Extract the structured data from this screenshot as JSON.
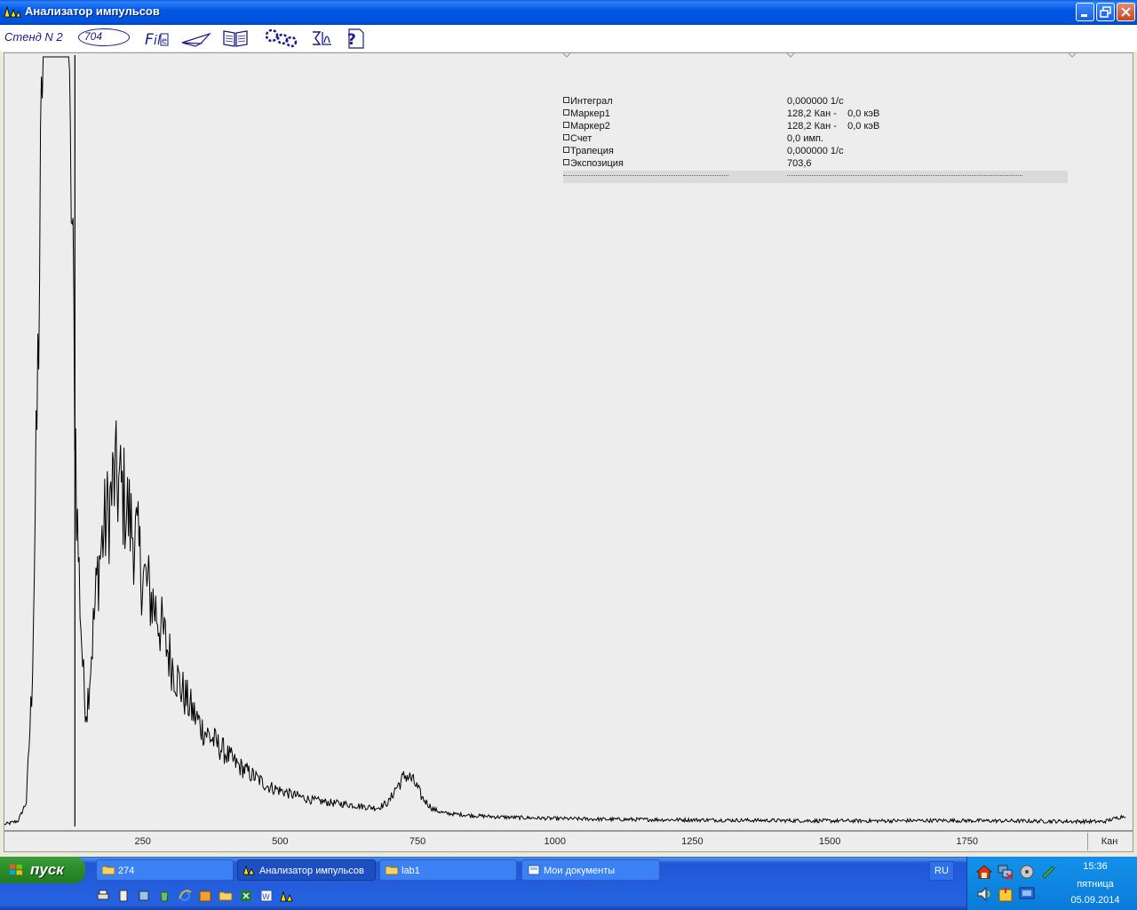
{
  "window": {
    "title": "Анализатор импульсов"
  },
  "toolbar": {
    "stand_label": "Стенд N 2",
    "counter_value": "704",
    "icons": [
      "file-icon",
      "plane-icon",
      "book-icon",
      "gears-icon",
      "sigma-chart-icon",
      "help-icon"
    ]
  },
  "info_panel": {
    "rows": [
      {
        "name": "Интеграл",
        "value": "0,000000 1/с"
      },
      {
        "name": "Маркер1",
        "value": "128,2 Кан -    0,0 кэВ"
      },
      {
        "name": "Маркер2",
        "value": "128,2 Кан -    0,0 кэВ"
      },
      {
        "name": "Счет",
        "value": "0,0 имп."
      },
      {
        "name": "Трапеция",
        "value": "0,000000 1/с"
      },
      {
        "name": "Экспозиция",
        "value": "703,6"
      }
    ]
  },
  "chart_data": {
    "type": "line",
    "xlabel": "Кан",
    "x_ticks": [
      250,
      500,
      750,
      1000,
      1250,
      1500,
      1750
    ],
    "x_range": [
      0,
      2048
    ],
    "marker_channel": 128.2,
    "peak_clipped": true,
    "series": [
      {
        "points": [
          [
            0,
            0.0
          ],
          [
            25,
            0.5
          ],
          [
            40,
            3
          ],
          [
            50,
            18
          ],
          [
            60,
            55
          ],
          [
            70,
            100
          ],
          [
            80,
            100
          ],
          [
            100,
            100
          ],
          [
            110,
            100
          ],
          [
            118,
            100
          ],
          [
            126,
            65
          ],
          [
            132,
            40
          ],
          [
            140,
            25
          ],
          [
            145,
            17
          ],
          [
            150,
            15
          ],
          [
            160,
            24
          ],
          [
            170,
            33
          ],
          [
            180,
            38
          ],
          [
            190,
            41
          ],
          [
            200,
            45
          ],
          [
            210,
            44
          ],
          [
            220,
            42
          ],
          [
            230,
            39
          ],
          [
            240,
            37
          ],
          [
            250,
            33
          ],
          [
            260,
            31
          ],
          [
            280,
            27
          ],
          [
            300,
            22
          ],
          [
            320,
            18
          ],
          [
            340,
            15
          ],
          [
            360,
            12.5
          ],
          [
            380,
            11
          ],
          [
            400,
            9.5
          ],
          [
            420,
            8
          ],
          [
            440,
            7
          ],
          [
            460,
            6
          ],
          [
            480,
            5
          ],
          [
            500,
            4.5
          ],
          [
            520,
            4
          ],
          [
            540,
            3.6
          ],
          [
            560,
            3.2
          ],
          [
            580,
            3
          ],
          [
            600,
            2.8
          ],
          [
            620,
            2.7
          ],
          [
            640,
            2.5
          ],
          [
            660,
            2.3
          ],
          [
            680,
            2.2
          ],
          [
            700,
            3
          ],
          [
            710,
            4.5
          ],
          [
            720,
            5.5
          ],
          [
            730,
            6.5
          ],
          [
            740,
            6
          ],
          [
            750,
            5
          ],
          [
            760,
            3.5
          ],
          [
            780,
            2
          ],
          [
            800,
            1.5
          ],
          [
            850,
            1.2
          ],
          [
            900,
            1
          ],
          [
            1000,
            0.8
          ],
          [
            1100,
            0.7
          ],
          [
            1200,
            0.65
          ],
          [
            1300,
            0.6
          ],
          [
            1400,
            0.55
          ],
          [
            1500,
            0.5
          ],
          [
            1600,
            0.5
          ],
          [
            1700,
            0.55
          ],
          [
            1800,
            0.5
          ],
          [
            1900,
            0.45
          ],
          [
            2000,
            0.4
          ],
          [
            2040,
            1.2
          ]
        ]
      }
    ]
  },
  "taskbar": {
    "start_label": "пуск",
    "tasks": [
      {
        "label": "274",
        "icon": "folder-icon"
      },
      {
        "label": "Анализатор импульсов",
        "icon": "app-icon",
        "active": true
      },
      {
        "label": "lab1",
        "icon": "folder-icon"
      },
      {
        "label": "Мои документы",
        "icon": "documents-icon"
      }
    ],
    "language": "RU",
    "clock": {
      "time": "15:36",
      "day": "пятница",
      "date": "05.09.2014"
    }
  }
}
